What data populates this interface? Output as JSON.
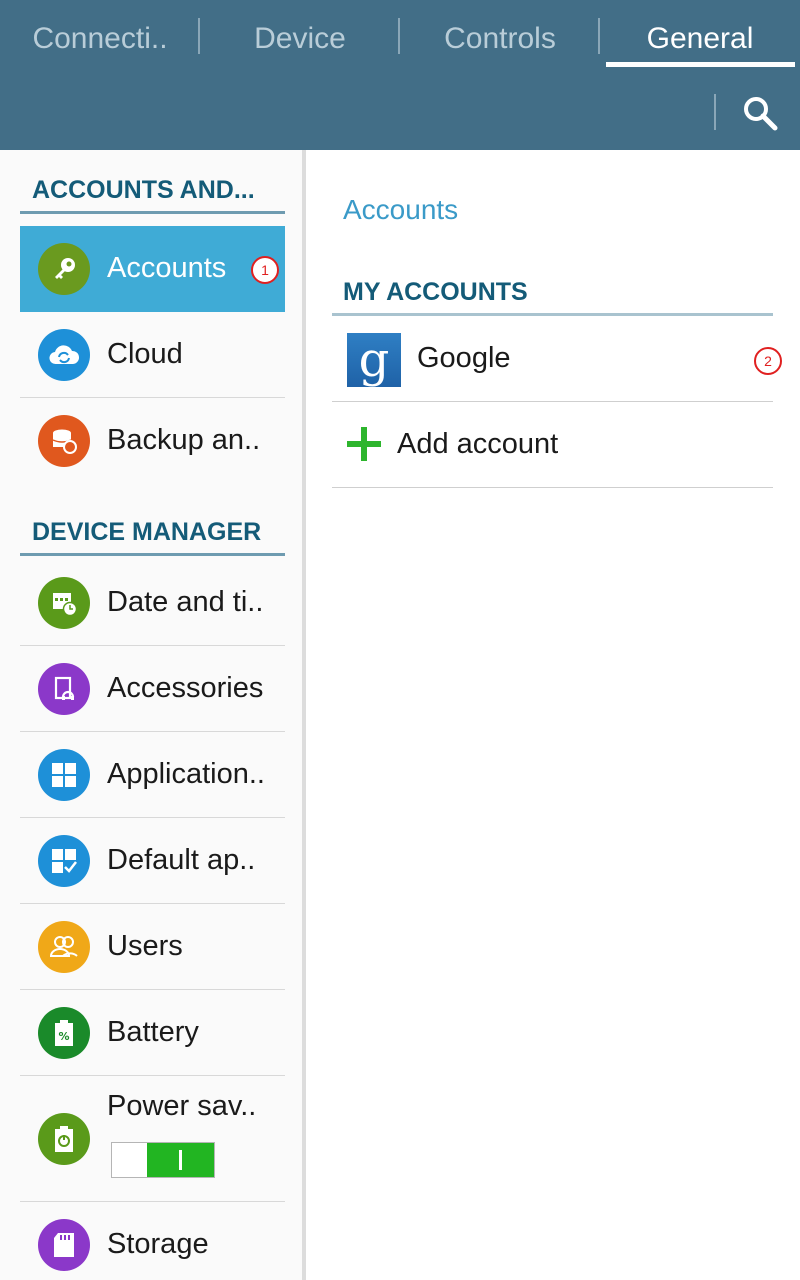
{
  "header": {
    "tabs": [
      {
        "label": "Connecti..",
        "active": false
      },
      {
        "label": "Device",
        "active": false
      },
      {
        "label": "Controls",
        "active": false
      },
      {
        "label": "General",
        "active": true
      }
    ],
    "search_icon": "search-icon"
  },
  "sidebar": {
    "sections": [
      {
        "title": "ACCOUNTS AND..."
      },
      {
        "title": "DEVICE MANAGER"
      }
    ],
    "items": [
      {
        "label": "Accounts",
        "icon": "key-icon",
        "color": "#6a9a1f",
        "selected": true,
        "badge": "1"
      },
      {
        "label": "Cloud",
        "icon": "cloud-sync-icon",
        "color": "#1e90d8"
      },
      {
        "label": "Backup an..",
        "icon": "backup-icon",
        "color": "#e0581e"
      },
      {
        "label": "Date and ti..",
        "icon": "calendar-clock-icon",
        "color": "#5a9a1a"
      },
      {
        "label": "Accessories",
        "icon": "accessories-icon",
        "color": "#8b38c9"
      },
      {
        "label": "Application..",
        "icon": "apps-grid-icon",
        "color": "#1e90d8"
      },
      {
        "label": "Default ap..",
        "icon": "default-apps-icon",
        "color": "#1e90d8"
      },
      {
        "label": "Users",
        "icon": "users-icon",
        "color": "#f0a818"
      },
      {
        "label": "Battery",
        "icon": "battery-icon",
        "color": "#1a8a2a"
      },
      {
        "label": "Power sav..",
        "icon": "power-saving-icon",
        "color": "#5a9a1a",
        "toggle_on": true
      },
      {
        "label": "Storage",
        "icon": "sd-card-icon",
        "color": "#8b38c9"
      }
    ]
  },
  "main": {
    "breadcrumb": "Accounts",
    "section_title": "MY ACCOUNTS",
    "accounts": [
      {
        "label": "Google",
        "icon": "google-icon",
        "logo_letter": "g",
        "badge": "2"
      }
    ],
    "add_account_label": "Add account"
  }
}
